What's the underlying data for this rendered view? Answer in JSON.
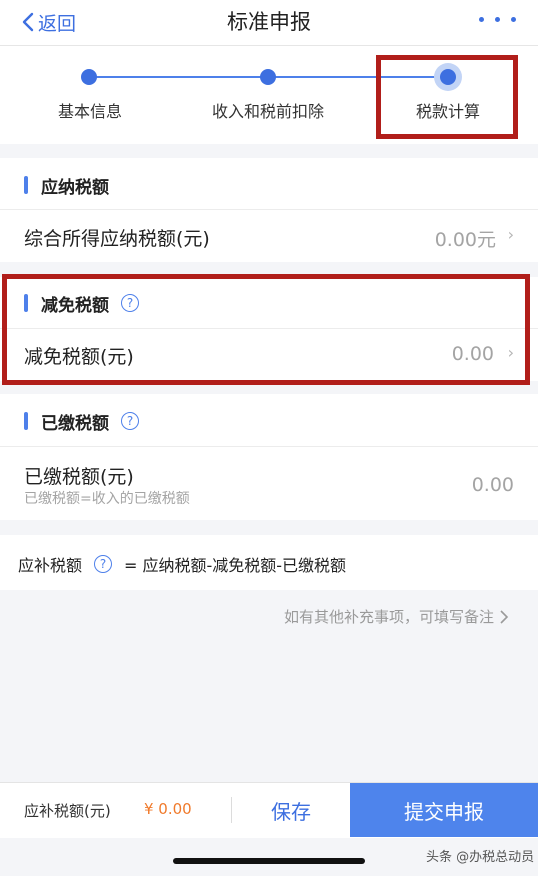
{
  "nav": {
    "back_label": "返回",
    "title": "标准申报"
  },
  "steps": [
    {
      "label": "基本信息"
    },
    {
      "label": "收入和税前扣除"
    },
    {
      "label": "税款计算"
    }
  ],
  "payable": {
    "title": "应纳税额",
    "row_label": "综合所得应纳税额(元)",
    "row_value": "0.00元"
  },
  "reduction": {
    "title": "减免税额",
    "help": "?",
    "row_label": "减免税额(元)",
    "row_value": "0.00"
  },
  "paid": {
    "title": "已缴税额",
    "help": "?",
    "row_label": "已缴税额(元)",
    "row_sub": "已缴税额=收入的已缴税额",
    "row_value": "0.00"
  },
  "formula": {
    "label": "应补税额",
    "help": "?",
    "expression": "= 应纳税额-减免税额-已缴税额"
  },
  "note": "如有其他补充事项，可填写备注",
  "bottom": {
    "due_label": "应补税额(元)",
    "due_value": "¥ 0.00",
    "save_label": "保存",
    "submit_label": "提交申报"
  },
  "watermark": "头条 @办税总动员",
  "colors": {
    "accent": "#3d6fe0",
    "highlight_box": "#b11e1a",
    "amount": "#f07a2b"
  }
}
